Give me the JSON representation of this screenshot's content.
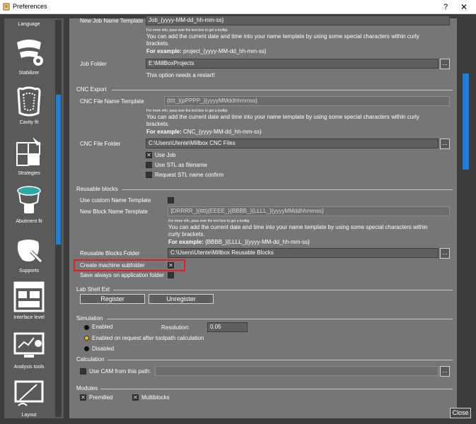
{
  "window": {
    "title": "Preferences",
    "help": "?",
    "close_glyph": "✕"
  },
  "sidebar": {
    "items": [
      {
        "label": "Language",
        "icon": "language-icon"
      },
      {
        "label": "Stabilizer",
        "icon": "stabilizer-icon"
      },
      {
        "label": "Cavity fit",
        "icon": "cavity-fit-icon"
      },
      {
        "label": "Strategies",
        "icon": "strategies-icon"
      },
      {
        "label": "Abutment fit",
        "icon": "abutment-fit-icon"
      },
      {
        "label": "Supports",
        "icon": "supports-icon"
      },
      {
        "label": "Interface level",
        "icon": "interface-level-icon"
      },
      {
        "label": "Analysis tools",
        "icon": "analysis-tools-icon"
      },
      {
        "label": "Layout",
        "icon": "layout-icon"
      }
    ]
  },
  "job": {
    "name_template_label": "New Job Name Template",
    "name_template_value": "Job_{yyyy-MM-dd_hh-mm-ss}",
    "tip_small": "For more info, pass over the text box to get a tooltip.",
    "tip_line1": "You can add the current date and time into your name template by using some special characters within curly",
    "tip_line2": "brackets.",
    "example_label": "For example:",
    "example_value": "project_{yyyy-MM-dd_hh-mm-ss}",
    "folder_label": "Job Folder",
    "folder_value": "E:\\MillBoxProjects",
    "restart_note": "This option needs a restart!"
  },
  "cnc": {
    "section": "CNC Export",
    "name_template_label": "CNC File Name Template",
    "name_template_value": "{tttt_}{pPPPP_}{yyyyMMddhhmmss}",
    "tip_small": "For more info, pass over the text box to get a tooltip.",
    "tip_line1": "You can add the current date and time into your name template by using some special characters within curly",
    "tip_line2": "brackets.",
    "example_label": "For example:",
    "example_value": "CNC_{yyyy-MM-dd_hh-mm-ss}",
    "folder_label": "CNC File Folder",
    "folder_value": "C:\\Users\\Utente\\Millbox CNC Files",
    "use_job": "Use Job",
    "use_stl": "Use STL as filename",
    "request_stl": "Request STL name confirm"
  },
  "blocks": {
    "section": "Reusable blocks",
    "use_custom": "Use custom Name Template",
    "name_template_label": "New Block Name Template",
    "name_template_value": "{DRRRR_}{tttt}{EEEE_}{BBBB_}{LLLL_}{yyyyMMddhhmmss}",
    "tip_small": "For more info, pass over the text box to get a tooltip.",
    "tip_line1": "You can add the current date and time into your name template by using some special characters within",
    "tip_line2": "curly brackets.",
    "example_label": "For example:",
    "example_value": "{BBBB_}{LLLL_}{yyyy-MM-dd_hh-mm-ss}",
    "folder_label": "Reusable Blocks Folder",
    "folder_value": "C:\\Users\\Utente\\Millbox Reusable Blocks",
    "create_subfolder": "Create machine subfolder",
    "save_always": "Save always on application folder"
  },
  "labshell": {
    "section": "Lab Shell Ext",
    "register": "Register",
    "unregister": "Unregister"
  },
  "simulation": {
    "section": "Simulation",
    "enabled": "Enabled",
    "resolution_label": "Resolution:",
    "resolution_value": "0.05",
    "on_request": "Enabled on request after toolpath calculation",
    "disabled": "Disabled"
  },
  "calculation": {
    "section": "Calculation",
    "use_cam": "Use CAM from this path:",
    "cam_path": ""
  },
  "modules": {
    "section": "Modules",
    "premilled": "Premilled",
    "multiblocks": "Multiblocks"
  },
  "browse": "...",
  "checked_glyph": "✕",
  "close_label": "Close",
  "colors": {
    "accent": "#1e7fd8",
    "highlight": "#e02020",
    "radio_selected": "#f0c000"
  }
}
